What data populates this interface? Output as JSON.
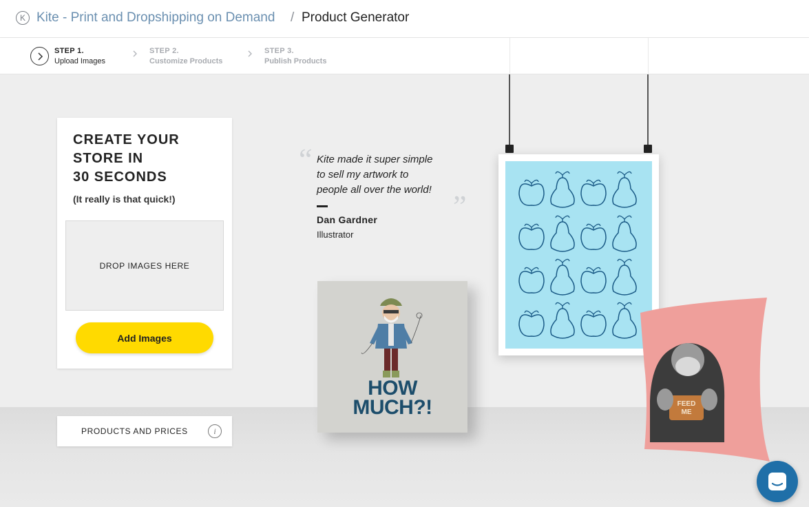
{
  "header": {
    "logo_letter": "K",
    "app_name": "Kite - Print and Dropshipping on Demand",
    "separator": "/",
    "page_title": "Product Generator"
  },
  "steps": [
    {
      "number": "STEP 1.",
      "label": "Upload Images",
      "state": "active"
    },
    {
      "number": "STEP 2.",
      "label": "Customize Products",
      "state": "inactive"
    },
    {
      "number": "STEP 3.",
      "label": "Publish Products",
      "state": "inactive"
    }
  ],
  "panel": {
    "title": "CREATE YOUR\nSTORE IN\n30 SECONDS",
    "subtitle": "(It really is that quick!)",
    "dropzone_label": "DROP IMAGES HERE",
    "add_button_label": "Add Images"
  },
  "products_bar": {
    "label": "PRODUCTS AND PRICES",
    "info_glyph": "i"
  },
  "testimonial": {
    "open_quote": "“",
    "close_quote": "”",
    "text": "Kite made it super simple\nto sell my artwork to\npeople all over the world!",
    "author": "Dan Gardner",
    "role": "Illustrator"
  },
  "products": {
    "canvas_text_line1": "HOW",
    "canvas_text_line2": "MUCH?!",
    "pillow_text_line1": "FEED",
    "pillow_text_line2": "ME"
  },
  "colors": {
    "accent_yellow": "#ffda00",
    "link_blue": "#6a8fb0",
    "poster_blue": "#a8e3f2",
    "poster_line": "#1a5a86",
    "pillow_pink": "#ef9f9b",
    "chat_blue": "#1f6fa8"
  },
  "icons": {
    "logo": "kite-logo-icon",
    "step_arrow": "chevron-right-circle-icon",
    "step_separator": "chevron-right-icon",
    "info": "info-icon",
    "chat": "chat-icon"
  }
}
